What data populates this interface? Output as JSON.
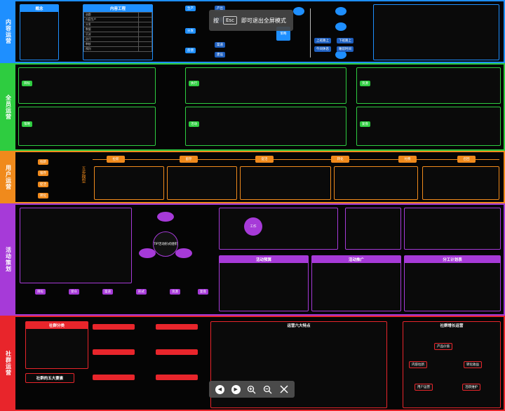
{
  "colors": {
    "blue": "#1e8fff",
    "green": "#2ecc40",
    "orange": "#f08a1c",
    "purple": "#a63ad8",
    "red": "#e8252b"
  },
  "sections": {
    "content": {
      "label": "内容运营",
      "left_title": "概念",
      "table_title": "内容工程",
      "table_rows": [
        "选题",
        "内容生产",
        "分发",
        "数据",
        "沉淀",
        "迭代",
        "审核",
        "预判"
      ],
      "mid_chips": [
        "生产",
        "产出",
        "内容",
        "分发",
        "反馈",
        "渠道",
        "建设"
      ],
      "center_node": "策略",
      "right_chips": [
        "上班路上",
        "下班路上",
        "午间休息",
        "睡前时间"
      ]
    },
    "all_staff": {
      "label": "全员运营",
      "box_titles": [
        "目标",
        "策略",
        "执行",
        "活动",
        "资源",
        "复盘"
      ]
    },
    "user": {
      "label": "用户运营",
      "left_chips": [
        "拉新",
        "留存",
        "促活",
        "转化"
      ],
      "steps": [
        "拉新",
        "留存",
        "促活",
        "转化",
        "付费",
        "召回"
      ],
      "model_label": "五步模型"
    },
    "activity": {
      "label": "活动策划",
      "tip_center": "TIP活动形式组织",
      "work_center": "工作",
      "table_titles": [
        "活动预算",
        "活动推广",
        "分工计划表"
      ],
      "bottom_boxes": [
        "目标",
        "受众",
        "渠道",
        "形式",
        "资源",
        "复盘"
      ]
    },
    "social": {
      "label": "社群运营",
      "table_title": "社群分类",
      "six_title": "运营六大特点",
      "five_title": "社群的五大要素",
      "right_title": "社群增长运营",
      "cycle_nodes": [
        "产品价值",
        "内容拉新",
        "转化收益",
        "用户运营",
        "活跃维护"
      ]
    }
  },
  "overlay": {
    "key": "Esc",
    "pre": "按",
    "message": "即可退出全屏模式"
  },
  "toolbar": {
    "buttons": [
      "prev",
      "next",
      "zoom-in",
      "zoom-out",
      "close"
    ]
  }
}
